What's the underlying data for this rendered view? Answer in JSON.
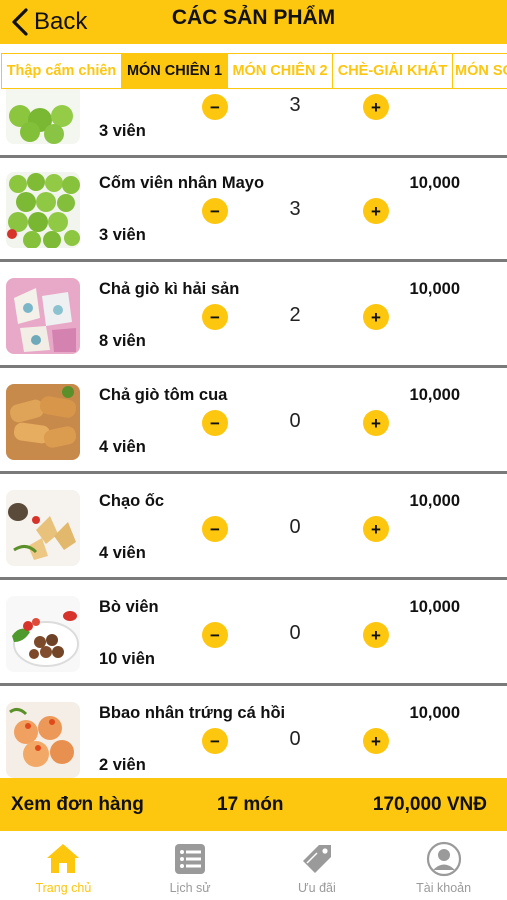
{
  "header": {
    "back_label": "Back",
    "title": "CÁC SẢN PHẨM"
  },
  "tabs": [
    {
      "label": "Thập cẩm chiên",
      "active": false
    },
    {
      "label": "MÓN CHIÊN 1",
      "active": true
    },
    {
      "label": "MÓN CHIÊN 2",
      "active": false
    },
    {
      "label": "CHÈ-GIẢI KHÁT",
      "active": false
    },
    {
      "label": "MÓN SỢI",
      "active": false
    }
  ],
  "products": [
    {
      "name": "",
      "price": "",
      "unit": "3 viên",
      "qty": "3",
      "thumb": "green-balls"
    },
    {
      "name": "Cốm viên nhân Mayo",
      "price": "10,000",
      "unit": "3 viên",
      "qty": "3",
      "thumb": "green-balls"
    },
    {
      "name": "Chả giò kì hải sản",
      "price": "10,000",
      "unit": "8 viên",
      "qty": "2",
      "thumb": "seafood-rolls"
    },
    {
      "name": "Chả giò tôm cua",
      "price": "10,000",
      "unit": "4 viên",
      "qty": "0",
      "thumb": "fried-rolls"
    },
    {
      "name": "Chạo ốc",
      "price": "10,000",
      "unit": "4 viên",
      "qty": "0",
      "thumb": "snail-cakes"
    },
    {
      "name": "Bò viên",
      "price": "10,000",
      "unit": "10 viên",
      "qty": "0",
      "thumb": "beef-balls"
    },
    {
      "name": "Bbao nhân trứng cá hồi",
      "price": "10,000",
      "unit": "2 viên",
      "qty": "0",
      "thumb": "salmon-buns"
    }
  ],
  "qty_controls": {
    "minus": "−",
    "plus": "+"
  },
  "summary": {
    "view_order": "Xem đơn hàng",
    "count": "17 món",
    "total": "170,000 VNĐ"
  },
  "nav": [
    {
      "label": "Trang chủ",
      "icon": "home-icon",
      "active": true
    },
    {
      "label": "Lịch sử",
      "icon": "history-list-icon",
      "active": false
    },
    {
      "label": "Ưu đãi",
      "icon": "tag-icon",
      "active": false
    },
    {
      "label": "Tài khoản",
      "icon": "account-icon",
      "active": false
    }
  ],
  "colors": {
    "accent": "#fdc60f",
    "separator": "#7a7a7a",
    "nav_inactive": "#9a9a9a"
  }
}
